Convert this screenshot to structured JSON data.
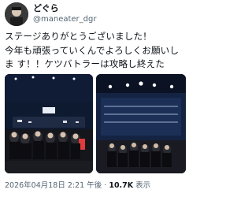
{
  "tweet": {
    "display_name": "どぐら",
    "handle": "@maneater_dgr",
    "text": "ステージありがとうございました！\n今年も頑張っていくんでよろしくお願いしま す！！ケツバトラーは攻略し終えた",
    "timestamp": "2026年04月18日 2:21 午後",
    "separator": "·",
    "view_count": "10.7K",
    "view_label": "表示"
  },
  "media": {
    "photos": [
      {
        "name": "stage-group-photo-left"
      },
      {
        "name": "stage-group-photo-right"
      }
    ]
  },
  "icons": {
    "avatar": "user-avatar-photo"
  }
}
